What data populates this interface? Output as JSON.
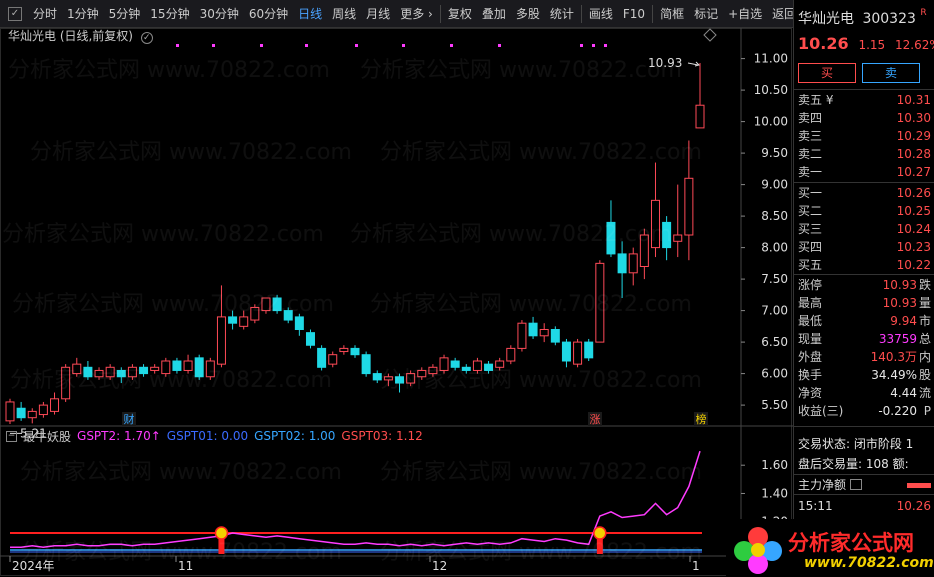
{
  "toolbar": {
    "check": "✓",
    "items": [
      "分时",
      "1分钟",
      "5分钟",
      "15分钟",
      "30分钟",
      "60分钟",
      "日线",
      "周线",
      "月线",
      "更多 ›",
      "复权",
      "叠加",
      "多股",
      "统计",
      "画线",
      "F10",
      "简框",
      "标记",
      "+自选",
      "返回"
    ],
    "active": "日线"
  },
  "chart_title": "华灿光电 (日线,前复权)",
  "title_toggle": "✓",
  "price_axis": [
    "11.00",
    "10.50",
    "10.00",
    "9.50",
    "9.00",
    "8.50",
    "8.00",
    "7.50",
    "7.00",
    "6.50",
    "6.00",
    "5.50"
  ],
  "max_label": "10.93",
  "min_label": "5.21",
  "events": [
    {
      "label": "财",
      "x": 128
    },
    {
      "label": "涨",
      "x": 594
    },
    {
      "label": "榜",
      "x": 700
    }
  ],
  "indicator": {
    "name": "最牛妖股",
    "box": "−",
    "gspt2": "GSPT2: 1.70↑",
    "gspt01": "GSPT01: 0.00",
    "gspt02": "GSPT02: 1.00",
    "gspt03": "GSPT03: 1.12",
    "axis": [
      "1.60",
      "1.40",
      "1.20"
    ]
  },
  "date_axis": [
    "2024年",
    "11",
    "12",
    "1"
  ],
  "watermark": "分析家公式网 www.70822.com",
  "colors": {
    "up": "#ff4a57",
    "down": "#1fd9e6",
    "ind": "#ff3bff",
    "red": "#ff2020",
    "blue": "#3b6bff",
    "sky": "#36a6ff"
  },
  "side": {
    "name": "华灿光电",
    "code": "300323",
    "tag": "R",
    "price": "10.26",
    "change": "1.15",
    "pct": "12.62%",
    "buy": "买",
    "sell": "卖",
    "asks": [
      {
        "label": "卖五 ¥",
        "price": "10.31"
      },
      {
        "label": "卖四",
        "price": "10.30"
      },
      {
        "label": "卖三",
        "price": "10.29"
      },
      {
        "label": "卖二",
        "price": "10.28"
      },
      {
        "label": "卖一",
        "price": "10.27"
      }
    ],
    "bids": [
      {
        "label": "买一",
        "price": "10.26"
      },
      {
        "label": "买二",
        "price": "10.25"
      },
      {
        "label": "买三",
        "price": "10.24"
      },
      {
        "label": "买四",
        "price": "10.23"
      },
      {
        "label": "买五",
        "price": "10.22"
      }
    ],
    "stats": [
      {
        "label": "涨停",
        "value": "10.93",
        "suffix": "跌",
        "cls": "red"
      },
      {
        "label": "最高",
        "value": "10.93",
        "suffix": "量",
        "cls": "red"
      },
      {
        "label": "最低",
        "value": "9.94",
        "suffix": "市",
        "cls": "red"
      },
      {
        "label": "现量",
        "value": "33759",
        "suffix": "总",
        "cls": "magenta"
      },
      {
        "label": "外盘",
        "value": "140.3万",
        "suffix": "内",
        "cls": "red"
      },
      {
        "label": "换手",
        "value": "34.49%",
        "suffix": "股",
        "cls": "white"
      },
      {
        "label": "净资",
        "value": "4.44",
        "suffix": "流",
        "cls": "white"
      },
      {
        "label": "收益(三)",
        "value": "-0.220",
        "suffix": "P",
        "cls": "white"
      }
    ],
    "trade_status": "交易状态: 闭市阶段 1",
    "after_vol": "盘后交易量: 108  额:",
    "main_flow": "主力净额",
    "tick_time": "15:11",
    "tick_price": "10.26"
  },
  "logo": {
    "title": "分析家公式网",
    "url": "www.70822.com"
  },
  "chart_data": {
    "type": "candlestick",
    "ylim": [
      5.2,
      11.2
    ],
    "candles": [
      [
        5.25,
        5.55,
        5.6,
        5.2
      ],
      [
        5.45,
        5.3,
        5.55,
        5.25
      ],
      [
        5.3,
        5.4,
        5.45,
        5.21
      ],
      [
        5.35,
        5.5,
        5.55,
        5.3
      ],
      [
        5.4,
        5.6,
        5.7,
        5.35
      ],
      [
        5.6,
        6.1,
        6.15,
        5.55
      ],
      [
        6.0,
        6.15,
        6.25,
        5.95
      ],
      [
        6.1,
        5.95,
        6.2,
        5.9
      ],
      [
        5.95,
        6.05,
        6.1,
        5.9
      ],
      [
        5.95,
        6.1,
        6.15,
        5.9
      ],
      [
        6.05,
        5.95,
        6.1,
        5.85
      ],
      [
        5.95,
        6.1,
        6.15,
        5.9
      ],
      [
        6.1,
        6.0,
        6.15,
        5.95
      ],
      [
        6.05,
        6.1,
        6.15,
        6.0
      ],
      [
        6.0,
        6.2,
        6.25,
        5.95
      ],
      [
        6.2,
        6.05,
        6.25,
        6.0
      ],
      [
        6.05,
        6.2,
        6.3,
        6.0
      ],
      [
        6.25,
        5.95,
        6.3,
        5.9
      ],
      [
        5.95,
        6.2,
        6.25,
        5.9
      ],
      [
        6.15,
        6.9,
        7.4,
        6.1
      ],
      [
        6.9,
        6.8,
        7.0,
        6.7
      ],
      [
        6.75,
        6.9,
        7.0,
        6.7
      ],
      [
        6.85,
        7.05,
        7.1,
        6.8
      ],
      [
        7.0,
        7.2,
        7.2,
        6.95
      ],
      [
        7.2,
        7.0,
        7.25,
        6.95
      ],
      [
        7.0,
        6.85,
        7.05,
        6.8
      ],
      [
        6.9,
        6.7,
        6.95,
        6.6
      ],
      [
        6.65,
        6.45,
        6.7,
        6.4
      ],
      [
        6.4,
        6.1,
        6.45,
        6.05
      ],
      [
        6.15,
        6.3,
        6.35,
        6.1
      ],
      [
        6.35,
        6.4,
        6.45,
        6.3
      ],
      [
        6.4,
        6.3,
        6.45,
        6.25
      ],
      [
        6.3,
        6.0,
        6.35,
        5.95
      ],
      [
        6.0,
        5.9,
        6.05,
        5.85
      ],
      [
        5.9,
        5.95,
        6.0,
        5.8
      ],
      [
        5.95,
        5.85,
        6.0,
        5.7
      ],
      [
        5.85,
        6.0,
        6.05,
        5.8
      ],
      [
        5.95,
        6.05,
        6.1,
        5.9
      ],
      [
        6.0,
        6.1,
        6.15,
        5.95
      ],
      [
        6.05,
        6.25,
        6.3,
        6.0
      ],
      [
        6.2,
        6.1,
        6.25,
        6.05
      ],
      [
        6.1,
        6.05,
        6.15,
        6.0
      ],
      [
        6.05,
        6.2,
        6.25,
        6.0
      ],
      [
        6.15,
        6.05,
        6.2,
        6.0
      ],
      [
        6.1,
        6.2,
        6.25,
        6.05
      ],
      [
        6.2,
        6.4,
        6.45,
        6.15
      ],
      [
        6.4,
        6.8,
        6.85,
        6.35
      ],
      [
        6.8,
        6.6,
        6.9,
        6.55
      ],
      [
        6.6,
        6.7,
        6.8,
        6.5
      ],
      [
        6.7,
        6.5,
        6.75,
        6.45
      ],
      [
        6.5,
        6.2,
        6.55,
        6.1
      ],
      [
        6.15,
        6.5,
        6.55,
        6.1
      ],
      [
        6.5,
        6.25,
        6.55,
        6.2
      ],
      [
        6.5,
        7.75,
        7.8,
        6.5
      ],
      [
        8.4,
        7.9,
        8.75,
        7.85
      ],
      [
        7.9,
        7.6,
        8.1,
        7.2
      ],
      [
        7.6,
        7.9,
        8.0,
        7.4
      ],
      [
        7.7,
        8.2,
        8.3,
        7.5
      ],
      [
        8.0,
        8.75,
        9.35,
        7.85
      ],
      [
        8.4,
        8.0,
        8.5,
        7.8
      ],
      [
        8.1,
        8.2,
        9.0,
        7.85
      ],
      [
        8.2,
        9.1,
        9.7,
        7.8
      ],
      [
        9.9,
        10.26,
        10.93,
        9.94
      ]
    ],
    "indicator": [
      1.02,
      1.02,
      1.03,
      1.02,
      1.03,
      1.03,
      1.04,
      1.03,
      1.03,
      1.04,
      1.04,
      1.03,
      1.04,
      1.04,
      1.05,
      1.06,
      1.07,
      1.08,
      1.09,
      1.1,
      1.12,
      1.11,
      1.1,
      1.09,
      1.1,
      1.09,
      1.08,
      1.07,
      1.06,
      1.05,
      1.04,
      1.04,
      1.05,
      1.04,
      1.04,
      1.03,
      1.04,
      1.03,
      1.04,
      1.03,
      1.04,
      1.05,
      1.04,
      1.05,
      1.04,
      1.05,
      1.08,
      1.07,
      1.06,
      1.08,
      1.07,
      1.05,
      1.04,
      1.24,
      1.27,
      1.23,
      1.24,
      1.25,
      1.33,
      1.25,
      1.3,
      1.45,
      1.7
    ],
    "ind_ylim": [
      1.0,
      1.75
    ],
    "line_red": 1.12,
    "line_sky": 1.0,
    "signals": [
      19,
      53
    ]
  }
}
